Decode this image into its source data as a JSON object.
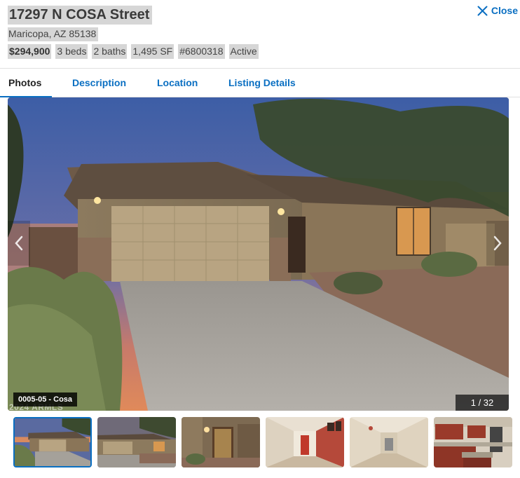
{
  "listing": {
    "street": "17297 N COSA Street",
    "city_line": "Maricopa, AZ 85138",
    "price": "$294,900",
    "beds": "3 beds",
    "baths": "2 baths",
    "sqft": "1,495 SF",
    "mls": "#6800318",
    "status": "Active"
  },
  "close": {
    "label": "Close",
    "icon": "close-icon"
  },
  "tabs": [
    {
      "label": "Photos",
      "active": true
    },
    {
      "label": "Description",
      "active": false
    },
    {
      "label": "Location",
      "active": false
    },
    {
      "label": "Listing Details",
      "active": false
    }
  ],
  "gallery": {
    "caption": "0005-05 - Cosa",
    "watermark": "2024 ARMLS",
    "current": 1,
    "total": 32,
    "counter_text": "1 / 32",
    "prev_icon": "chevron-left-icon",
    "next_icon": "chevron-right-icon"
  },
  "thumbnails": [
    {
      "scene": "front-exterior-dusk",
      "selected": true
    },
    {
      "scene": "front-exterior-angle",
      "selected": false
    },
    {
      "scene": "front-entry-door",
      "selected": false
    },
    {
      "scene": "hallway-red-accent",
      "selected": false
    },
    {
      "scene": "hallway-long",
      "selected": false
    },
    {
      "scene": "kitchen",
      "selected": false
    }
  ],
  "colors": {
    "accent": "#0a6fc2",
    "highlight": "#d6d6d6"
  }
}
